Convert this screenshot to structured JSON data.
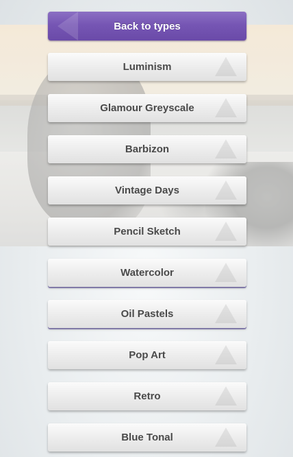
{
  "header": {
    "back_label": "Back to types"
  },
  "types": [
    {
      "label": "Luminism"
    },
    {
      "label": "Glamour Greyscale"
    },
    {
      "label": "Barbizon"
    },
    {
      "label": "Vintage Days"
    },
    {
      "label": "Pencil Sketch"
    },
    {
      "label": "Watercolor"
    },
    {
      "label": "Oil Pastels"
    },
    {
      "label": "Pop Art"
    },
    {
      "label": "Retro"
    },
    {
      "label": "Blue Tonal"
    }
  ],
  "colors": {
    "back_button": "#7656b4",
    "item_text": "#4a4a4a",
    "accent_underline": "#9d94cc"
  },
  "icons": {
    "back": "back-arrow-icon",
    "item": "triangle-icon"
  }
}
